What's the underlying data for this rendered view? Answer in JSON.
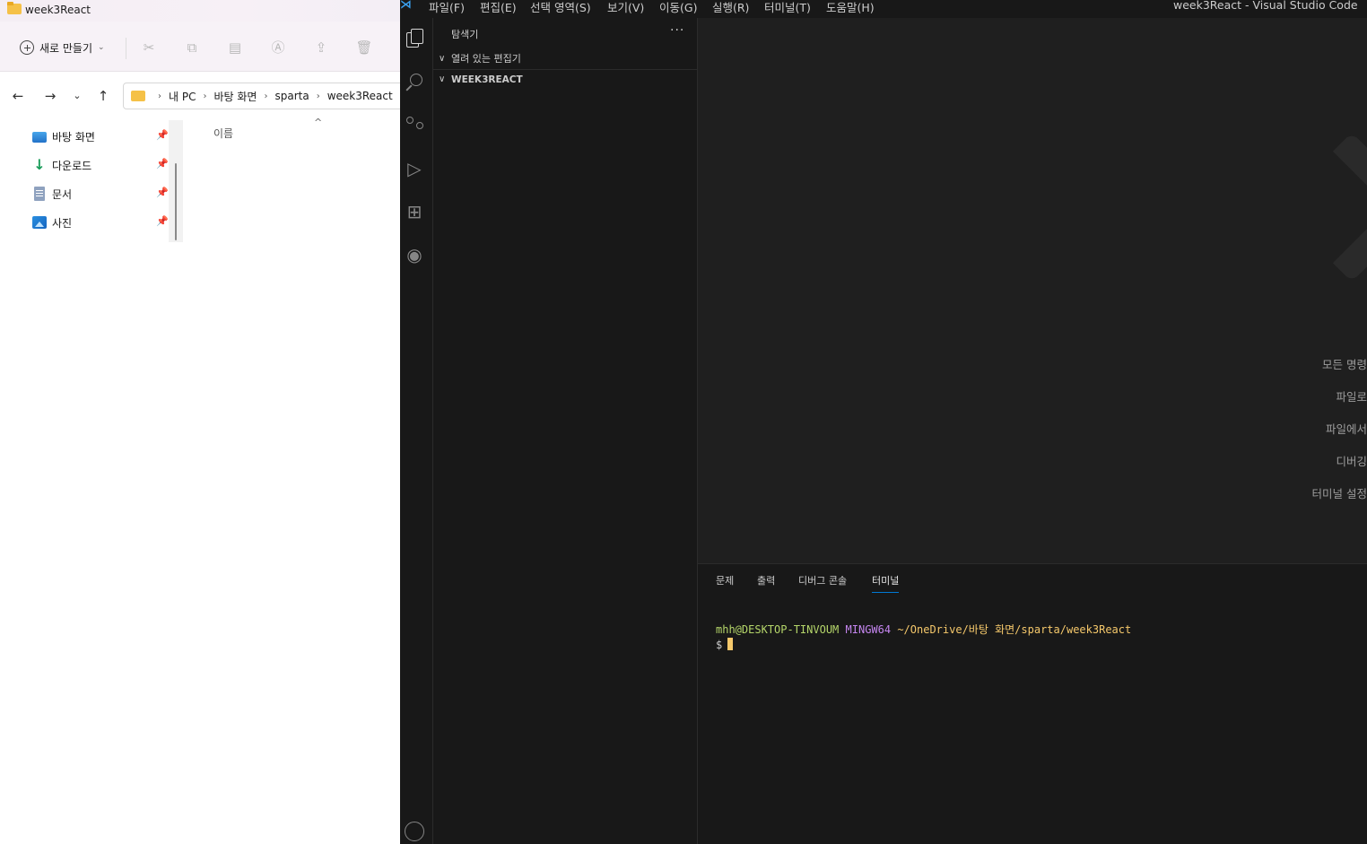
{
  "explorer": {
    "window_title": "week3React",
    "toolbar": {
      "new_label": "새로 만들기",
      "icons": [
        "cut-icon",
        "copy-icon",
        "paste-icon",
        "rename-icon",
        "share-icon",
        "delete-icon"
      ]
    },
    "breadcrumb": [
      "내 PC",
      "바탕 화면",
      "sparta",
      "week3React"
    ],
    "quick_access": [
      {
        "label": "바탕 화면",
        "icon": "desktop-icon"
      },
      {
        "label": "다운로드",
        "icon": "download-icon"
      },
      {
        "label": "문서",
        "icon": "documents-icon"
      },
      {
        "label": "사진",
        "icon": "pictures-icon"
      }
    ],
    "column_header": "이름"
  },
  "vscode": {
    "menu": [
      "파일(F)",
      "편집(E)",
      "선택 영역(S)",
      "보기(V)",
      "이동(G)",
      "실행(R)",
      "터미널(T)",
      "도움말(H)"
    ],
    "window_title": "week3React - Visual Studio Code",
    "sidebar": {
      "title": "탐색기",
      "more": "···",
      "sections": [
        "열려 있는 편집기",
        "WEEK3REACT"
      ]
    },
    "editor_shortcuts": [
      "모든 명령",
      "파일로",
      "파일에서",
      "디버깅",
      "터미널 설정"
    ],
    "panel": {
      "tabs": [
        "문제",
        "출력",
        "디버그 콘솔",
        "터미널"
      ],
      "active_tab": "터미널"
    },
    "terminal": {
      "user_host": "mhh@DESKTOP-TINVOUM",
      "env": "MINGW64",
      "path": "~/OneDrive/바탕 화면/sparta/week3React",
      "prompt": "$"
    },
    "colors": {
      "accent": "#0078d4",
      "terminal_user": "#b5d66a",
      "terminal_env": "#c586f0",
      "terminal_path": "#f5c86b"
    }
  }
}
